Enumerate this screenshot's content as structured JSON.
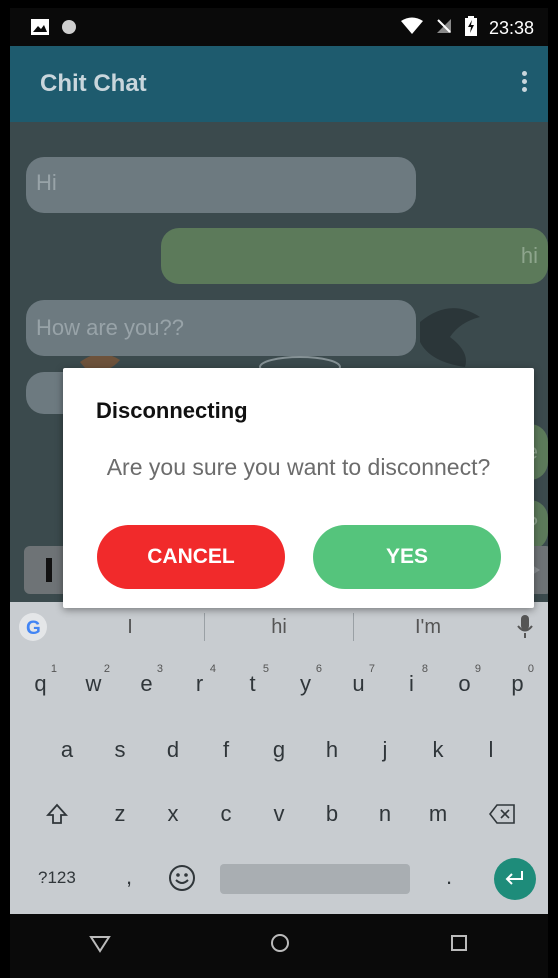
{
  "status_bar": {
    "time": "23:38"
  },
  "app_bar": {
    "title": "Chit Chat"
  },
  "messages": [
    {
      "side": "left",
      "text": "Hi"
    },
    {
      "side": "right",
      "text": "hi"
    },
    {
      "side": "left",
      "text": "How are you??"
    },
    {
      "side": "left",
      "text": ""
    },
    {
      "side": "right",
      "text": "ne"
    },
    {
      "side": "right",
      "text": "??"
    }
  ],
  "dialog": {
    "title": "Disconnecting",
    "message": "Are you sure you want to disconnect?",
    "cancel_label": "CANCEL",
    "yes_label": "YES"
  },
  "keyboard": {
    "suggestions": [
      "I",
      "hi",
      "I'm"
    ],
    "row1": [
      {
        "key": "q",
        "num": "1"
      },
      {
        "key": "w",
        "num": "2"
      },
      {
        "key": "e",
        "num": "3"
      },
      {
        "key": "r",
        "num": "4"
      },
      {
        "key": "t",
        "num": "5"
      },
      {
        "key": "y",
        "num": "6"
      },
      {
        "key": "u",
        "num": "7"
      },
      {
        "key": "i",
        "num": "8"
      },
      {
        "key": "o",
        "num": "9"
      },
      {
        "key": "p",
        "num": "0"
      }
    ],
    "row2": [
      "a",
      "s",
      "d",
      "f",
      "g",
      "h",
      "j",
      "k",
      "l"
    ],
    "row3": [
      "z",
      "x",
      "c",
      "v",
      "b",
      "n",
      "m"
    ],
    "symbols_label": "?123",
    "comma": ",",
    "period": "."
  },
  "colors": {
    "app_bar": "#1e5b6e",
    "cancel_button": "#f12a2b",
    "yes_button": "#55c47c",
    "enter_key": "#1e8c7a"
  }
}
